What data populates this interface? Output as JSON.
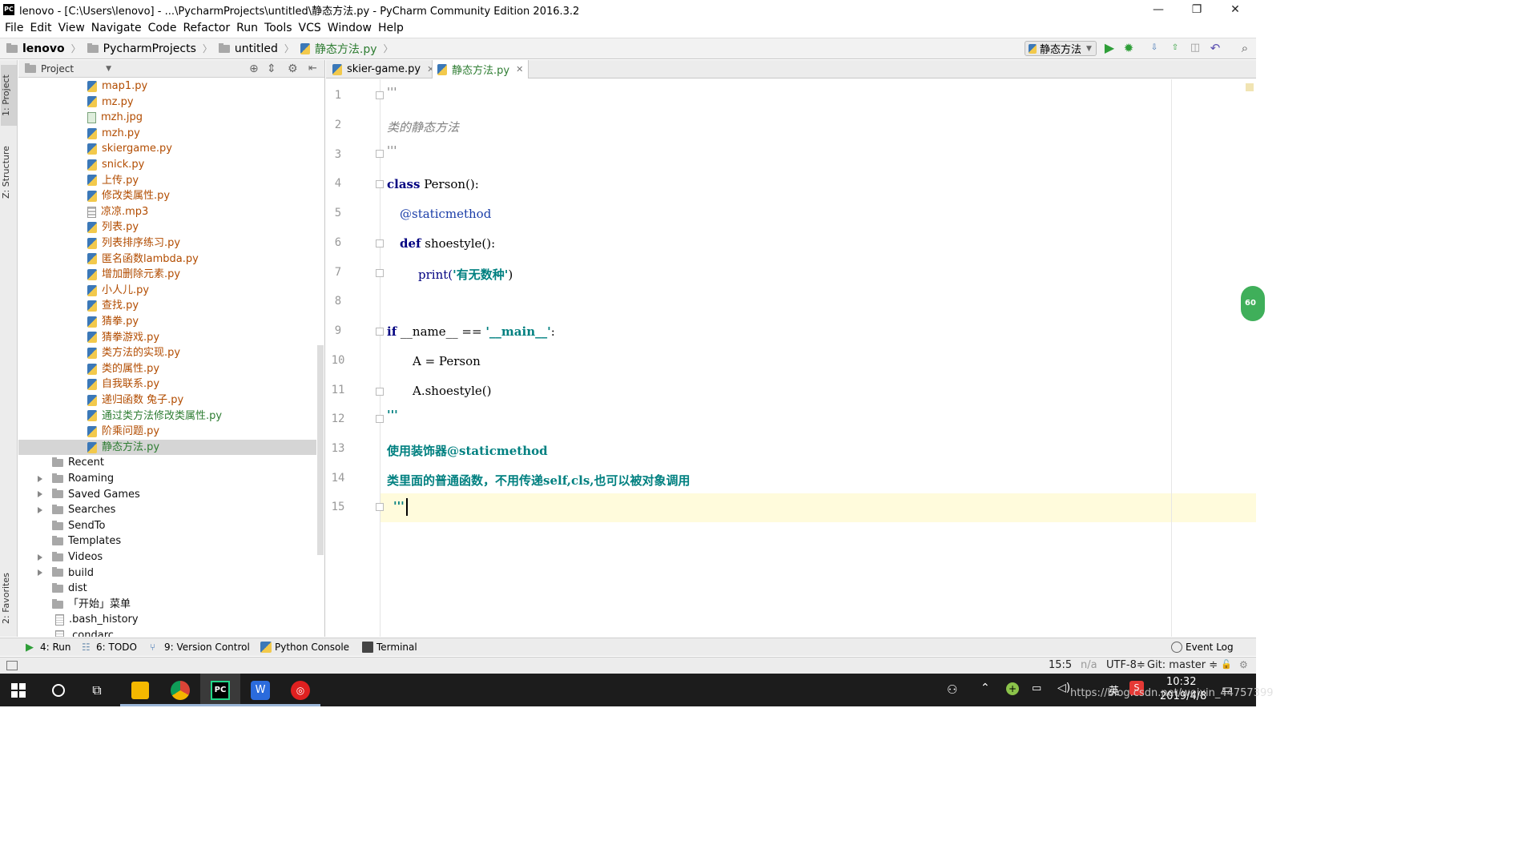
{
  "window": {
    "title": "lenovo - [C:\\Users\\lenovo] - ...\\PycharmProjects\\untitled\\静态方法.py - PyCharm Community Edition 2016.3.2",
    "minimize": "—",
    "restore": "❐",
    "close": "✕"
  },
  "menu": [
    "File",
    "Edit",
    "View",
    "Navigate",
    "Code",
    "Refactor",
    "Run",
    "Tools",
    "VCS",
    "Window",
    "Help"
  ],
  "breadcrumb": [
    "lenovo",
    "PycharmProjects",
    "untitled",
    "静态方法.py"
  ],
  "run_config": "静态方法",
  "side_tabs": {
    "project": "1: Project",
    "structure": "Z: Structure",
    "favorites": "2: Favorites"
  },
  "project_panel": {
    "title": "Project"
  },
  "tree": [
    {
      "label": "map1.py",
      "kind": "py"
    },
    {
      "label": "mz.py",
      "kind": "py"
    },
    {
      "label": "mzh.jpg",
      "kind": "img"
    },
    {
      "label": "mzh.py",
      "kind": "py"
    },
    {
      "label": "skiergame.py",
      "kind": "py"
    },
    {
      "label": "snick.py",
      "kind": "py"
    },
    {
      "label": "上传.py",
      "kind": "py"
    },
    {
      "label": "修改类属性.py",
      "kind": "py"
    },
    {
      "label": "凉凉.mp3",
      "kind": "mp3"
    },
    {
      "label": "列表.py",
      "kind": "py"
    },
    {
      "label": "列表排序练习.py",
      "kind": "py"
    },
    {
      "label": "匿名函数lambda.py",
      "kind": "py"
    },
    {
      "label": "增加删除元素.py",
      "kind": "py"
    },
    {
      "label": "小人儿.py",
      "kind": "py"
    },
    {
      "label": "查找.py",
      "kind": "py"
    },
    {
      "label": "猜拳.py",
      "kind": "py"
    },
    {
      "label": "猜拳游戏.py",
      "kind": "py"
    },
    {
      "label": "类方法的实现.py",
      "kind": "py"
    },
    {
      "label": "类的属性.py",
      "kind": "py"
    },
    {
      "label": "自我联系.py",
      "kind": "py"
    },
    {
      "label": "递归函数 兔子.py",
      "kind": "py"
    },
    {
      "label": "通过类方法修改类属性.py",
      "kind": "py-mod"
    },
    {
      "label": "阶乘问题.py",
      "kind": "py"
    },
    {
      "label": "静态方法.py",
      "kind": "py-sel"
    },
    {
      "label": "Recent",
      "kind": "dir"
    },
    {
      "label": "Roaming",
      "kind": "dir-exp"
    },
    {
      "label": "Saved Games",
      "kind": "dir-exp"
    },
    {
      "label": "Searches",
      "kind": "dir-exp"
    },
    {
      "label": "SendTo",
      "kind": "dir"
    },
    {
      "label": "Templates",
      "kind": "dir"
    },
    {
      "label": "Videos",
      "kind": "dir-exp"
    },
    {
      "label": "build",
      "kind": "dir-exp"
    },
    {
      "label": "dist",
      "kind": "dir"
    },
    {
      "label": "「开始」菜单",
      "kind": "dir"
    },
    {
      "label": ".bash_history",
      "kind": "txt"
    },
    {
      "label": ".condarc",
      "kind": "txt"
    }
  ],
  "tabs": [
    {
      "label": "skier-game.py",
      "close": "✕"
    },
    {
      "label": "静态方法.py",
      "close": "✕"
    }
  ],
  "code_lines": [
    "1",
    "2",
    "3",
    "4",
    "5",
    "6",
    "7",
    "8",
    "9",
    "10",
    "11",
    "12",
    "13",
    "14",
    "15"
  ],
  "code": {
    "l1": "'''",
    "l2": "类的静态方法",
    "l3": "'''",
    "l4_kw": "class",
    "l4_rest": " Person():",
    "l5": "@staticmethod",
    "l6_kw": "def",
    "l6_rest": " shoestyle():",
    "l7_fn": "print(",
    "l7_str": "'有无数种'",
    "l7_end": ")",
    "l9_kw": "if",
    "l9_mid": " __name__ == ",
    "l9_str": "'__main__'",
    "l9_end": ":",
    "l10": "A = Person",
    "l11": "A.shoestyle()",
    "l12": "'''",
    "l13": "使用装饰器@staticmethod",
    "l14": "类里面的普通函数，不用传递self,cls,也可以被对象调用",
    "l15": "'''"
  },
  "bottom_tools": {
    "run": "4: Run",
    "todo": "6: TODO",
    "vcs": "9: Version Control",
    "console": "Python Console",
    "terminal": "Terminal",
    "event_log": "Event Log"
  },
  "status": {
    "position": "15:5",
    "na": "n/a",
    "encoding": "UTF-8≑",
    "git": "Git: master ≑"
  },
  "taskbar": {
    "clock": "10:32",
    "date": "2019/4/8",
    "ime": "英",
    "watermark": "https://blog.csdn.net/weixin_44757399"
  },
  "colors": {
    "accent_green": "#2e7d32",
    "file_brown": "#b24c00",
    "keyword": "#000080",
    "string": "#008080"
  }
}
